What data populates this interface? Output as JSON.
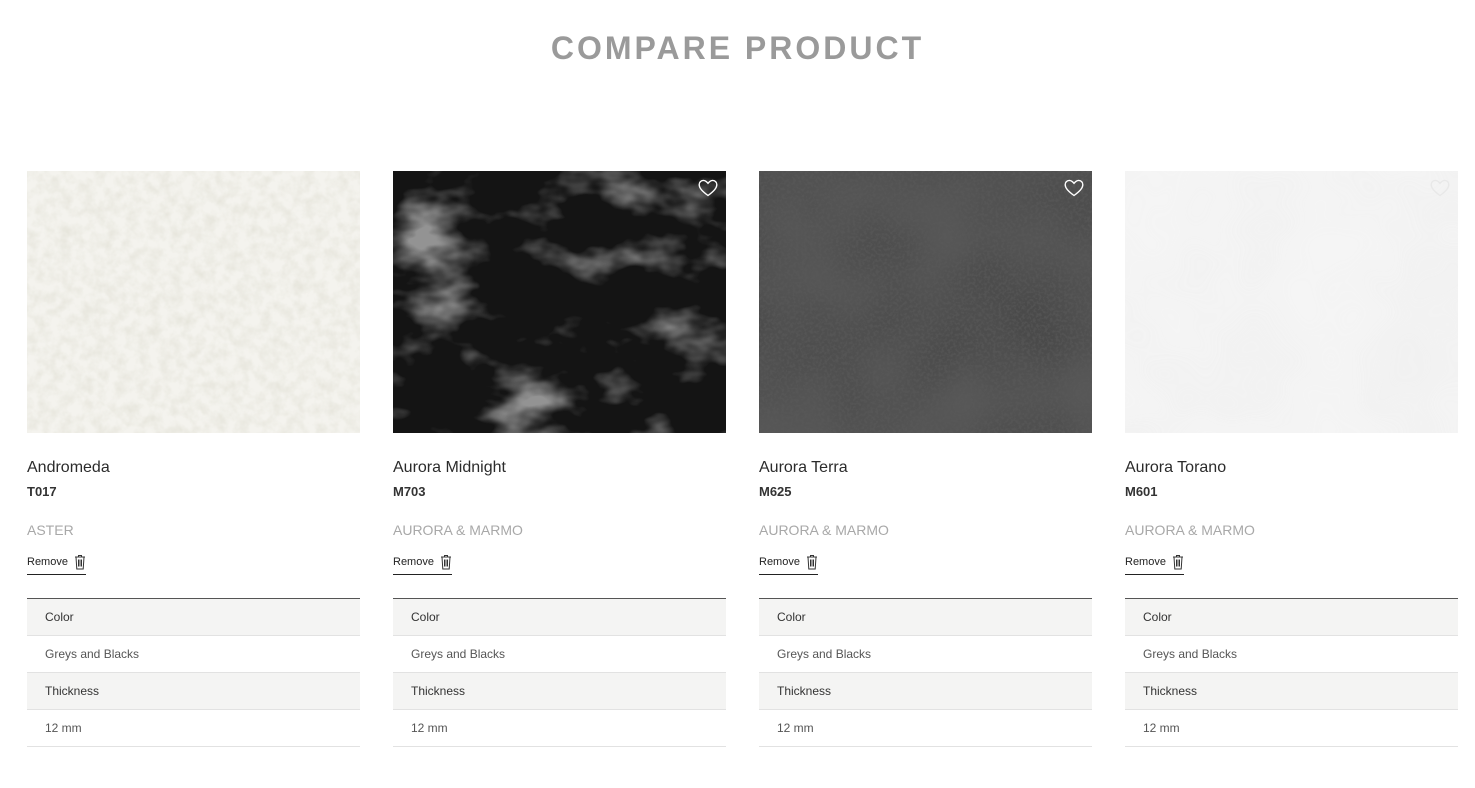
{
  "page": {
    "title": "COMPARE PRODUCT"
  },
  "products": [
    {
      "name": "Andromeda",
      "code": "T017",
      "collection": "ASTER",
      "remove_label": "Remove",
      "swatch_color": "#f4f3ee",
      "fleck_color": "#cfcdbe",
      "favorite_icon": "heart-outline-icon",
      "specs": {
        "color_label": "Color",
        "color_value": "Greys and Blacks",
        "thickness_label": "Thickness",
        "thickness_value": "12 mm"
      }
    },
    {
      "name": "Aurora Midnight",
      "code": "M703",
      "collection": "AURORA & MARMO",
      "remove_label": "Remove",
      "swatch_color": "#141414",
      "fleck_color": "#5a5a5a",
      "favorite_icon": "heart-outline-icon",
      "specs": {
        "color_label": "Color",
        "color_value": "Greys and Blacks",
        "thickness_label": "Thickness",
        "thickness_value": "12 mm"
      }
    },
    {
      "name": "Aurora Terra",
      "code": "M625",
      "collection": "AURORA & MARMO",
      "remove_label": "Remove",
      "swatch_color": "#4a4a4a",
      "fleck_color": "#262626",
      "favorite_icon": "heart-outline-icon",
      "specs": {
        "color_label": "Color",
        "color_value": "Greys and Blacks",
        "thickness_label": "Thickness",
        "thickness_value": "12 mm"
      }
    },
    {
      "name": "Aurora Torano",
      "code": "M601",
      "collection": "AURORA & MARMO",
      "remove_label": "Remove",
      "swatch_color": "#f5f5f5",
      "fleck_color": "#e2e2e2",
      "favorite_icon": "heart-outline-icon",
      "specs": {
        "color_label": "Color",
        "color_value": "Greys and Blacks",
        "thickness_label": "Thickness",
        "thickness_value": "12 mm"
      }
    }
  ]
}
